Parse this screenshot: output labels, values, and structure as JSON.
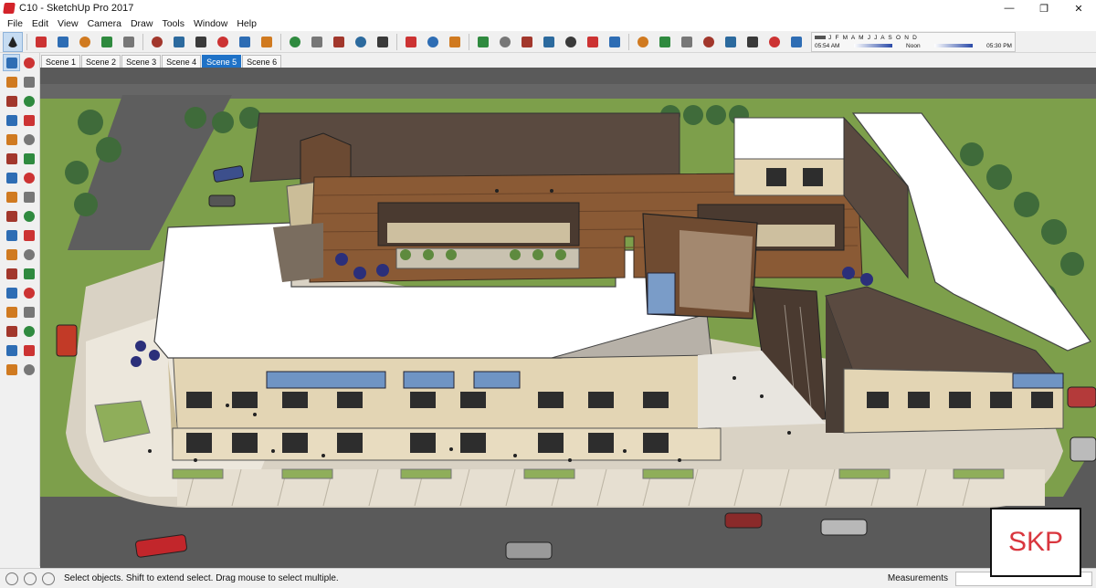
{
  "window": {
    "title": "C10 - SketchUp Pro 2017",
    "minimize": "—",
    "maximize": "❐",
    "close": "✕"
  },
  "menu": [
    "File",
    "Edit",
    "View",
    "Camera",
    "Draw",
    "Tools",
    "Window",
    "Help"
  ],
  "toolbar": {
    "tools": [
      "select-arrow",
      "eraser",
      "pencil-line",
      "arc",
      "shapes",
      "push-pull",
      "follow-me",
      "move",
      "rotate",
      "scale",
      "offset",
      "tape-measure",
      "paint-bucket",
      "orbit",
      "pan",
      "zoom",
      "zoom-extents",
      "components",
      "groups",
      "section-plane",
      "3d-warehouse",
      "extension-warehouse",
      "iso-view",
      "top-view",
      "front-view",
      "right-view",
      "back-view",
      "left-view",
      "xray",
      "wireframe",
      "hidden-line",
      "shaded",
      "textured",
      "monochrome",
      "shadows"
    ],
    "shadow_months": "J F M A M J J A S O N D",
    "shadow_time_start": "05:54 AM",
    "shadow_time_mid": "Noon",
    "shadow_time_end": "05:30 PM"
  },
  "scenes": [
    "Scene 1",
    "Scene 2",
    "Scene 3",
    "Scene 4",
    "Scene 5",
    "Scene 6"
  ],
  "active_scene": "Scene 5",
  "left_tools": [
    "select",
    "component",
    "paint",
    "eraser",
    "line",
    "freehand",
    "rectangle",
    "rotated-rect",
    "circle",
    "polygon",
    "arc",
    "pie",
    "move",
    "push-pull",
    "rotate",
    "follow-me",
    "scale",
    "offset",
    "tape",
    "text",
    "protractor",
    "axes",
    "dimensions",
    "3d-text",
    "orbit",
    "pan",
    "zoom",
    "zoom-window",
    "zoom-extents",
    "previous",
    "position-camera",
    "look-around",
    "walk",
    "section"
  ],
  "status": {
    "message": "Select objects. Shift to extend select. Drag mouse to select multiple.",
    "measurements_label": "Measurements",
    "measurements_value": ""
  },
  "watermark": "SKP",
  "colors": {
    "accent": "#1f72c7",
    "roof": "#ffffff",
    "facade": "#e3d5b4",
    "deck": "#8a5a35",
    "grass": "#7fa04a",
    "road": "#5a5a5a",
    "sidewalk": "#d8d0c2"
  }
}
